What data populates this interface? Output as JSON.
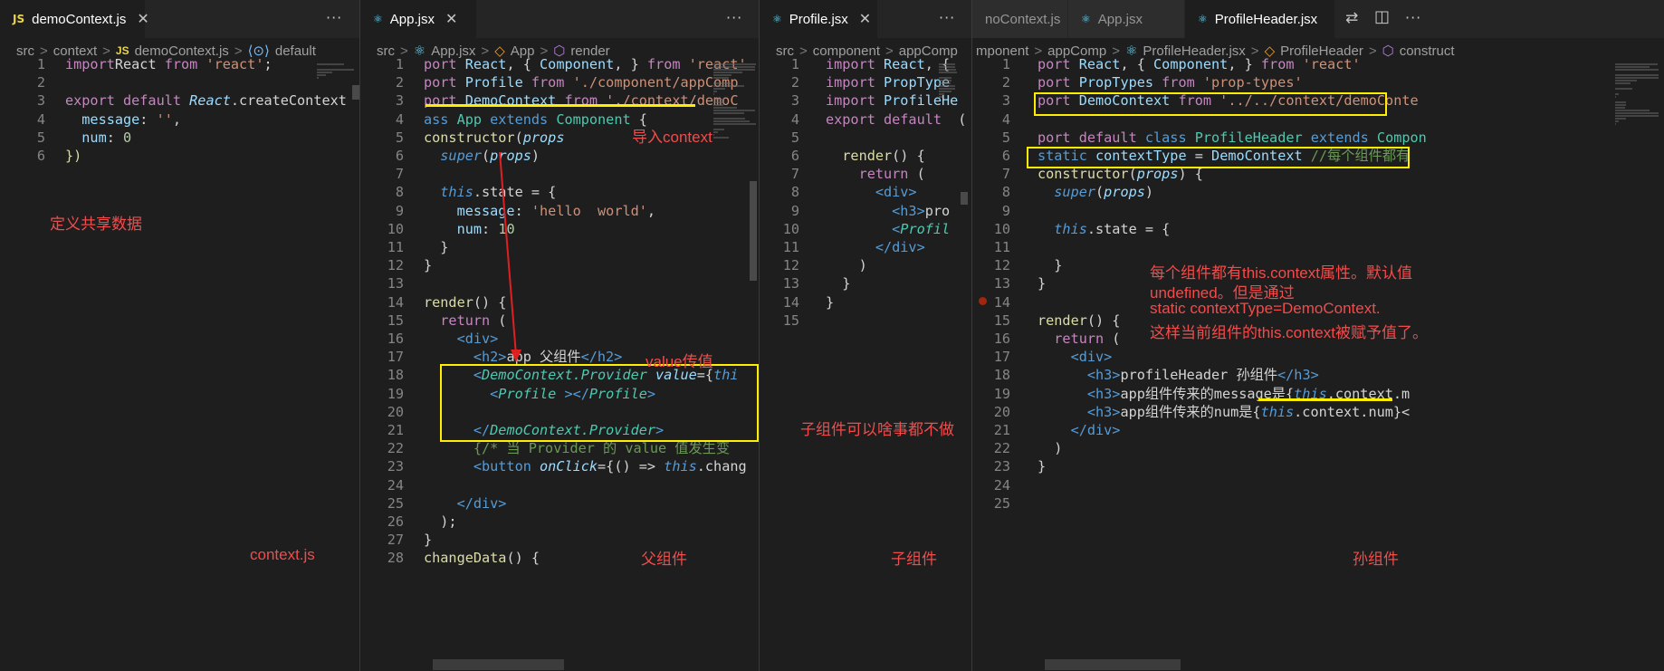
{
  "panes": [
    {
      "tab": {
        "icon": "JS",
        "title": "demoContext.js"
      },
      "breadcrumb": [
        "src",
        "context",
        "JS",
        "demoContext.js",
        "default"
      ],
      "lines": [
        [
          [
            "kw",
            "import"
          ],
          [
            "",
            "React"
          ],
          [
            "kw",
            " from"
          ],
          [
            "str",
            " 'react'"
          ],
          [
            "",
            ";"
          ]
        ],
        [],
        [
          [
            "kw",
            "export default"
          ],
          [
            "var it",
            " React"
          ],
          [
            "",
            ".createContext"
          ]
        ],
        [
          [
            "var",
            "  message"
          ],
          [
            "",
            ": "
          ],
          [
            "str",
            "''"
          ],
          [
            "",
            ","
          ]
        ],
        [
          [
            "var",
            "  num"
          ],
          [
            "",
            ": "
          ],
          [
            "num",
            "0"
          ]
        ],
        [
          [
            "fn",
            "})"
          ]
        ]
      ],
      "annotations": [
        "定义共享数据",
        "context.js"
      ]
    },
    {
      "tab": {
        "icon": "⚛",
        "title": "App.jsx"
      },
      "breadcrumb": [
        "src",
        "App.jsx",
        "App",
        "render"
      ],
      "lines": [
        [
          [
            "kw",
            "port"
          ],
          [
            "var",
            " React"
          ],
          [
            "",
            ", { "
          ],
          [
            "var",
            "Component"
          ],
          [
            "",
            ", } "
          ],
          [
            "kw",
            "from"
          ],
          [
            "str",
            " 'react'"
          ]
        ],
        [
          [
            "kw",
            "port"
          ],
          [
            "var",
            " Profile"
          ],
          [
            "kw",
            " from"
          ],
          [
            "str",
            " './component/appComp"
          ]
        ],
        [
          [
            "kw",
            "port"
          ],
          [
            "var",
            " DemoContext"
          ],
          [
            "kw",
            " from"
          ],
          [
            "str",
            " './context/demoC"
          ]
        ],
        [
          [
            "bl",
            "ass"
          ],
          [
            "cls",
            " App"
          ],
          [
            "bl",
            " extends"
          ],
          [
            "cls",
            " Component"
          ],
          [
            "",
            " {"
          ]
        ],
        [
          [
            "fn",
            "constructor"
          ],
          [
            "",
            "("
          ],
          [
            "var it",
            "props"
          ],
          [
            ") {",
            ""
          ]
        ],
        [
          [
            "bl it",
            "  super"
          ],
          [
            "",
            "("
          ],
          [
            "var it",
            "props"
          ],
          [
            "",
            ")"
          ]
        ],
        [],
        [
          [
            "bl it",
            "  this"
          ],
          [
            "",
            ".state = {"
          ]
        ],
        [
          [
            "var",
            "    message"
          ],
          [
            "",
            ": "
          ],
          [
            "str",
            "'hello  world'"
          ],
          [
            "",
            ","
          ]
        ],
        [
          [
            "var",
            "    num"
          ],
          [
            "",
            ": "
          ],
          [
            "num",
            "10"
          ]
        ],
        [
          [
            "",
            "  }"
          ]
        ],
        [
          [
            "",
            "}"
          ]
        ],
        [],
        [
          [
            "fn",
            "render"
          ],
          [
            "",
            "() {"
          ]
        ],
        [
          [
            "kw",
            "  return"
          ],
          [
            "",
            " ("
          ]
        ],
        [
          [
            "tag",
            "    <div>"
          ]
        ],
        [
          [
            "tag",
            "      <h2>"
          ],
          [
            "",
            "app 父组件"
          ],
          [
            "tag",
            "</h2>"
          ]
        ],
        [
          [
            "tag",
            "      <"
          ],
          [
            "cls it",
            "DemoContext.Provider"
          ],
          [
            "var it",
            " value"
          ],
          [
            "",
            "={"
          ],
          [
            "bl it",
            "thi"
          ]
        ],
        [
          [
            "tag",
            "        <"
          ],
          [
            "cls it",
            "Profile"
          ],
          [
            "tag",
            " ></"
          ],
          [
            "cls it",
            "Profile"
          ],
          [
            "tag",
            ">"
          ]
        ],
        [],
        [
          [
            "tag",
            "      </"
          ],
          [
            "cls it",
            "DemoContext.Provider"
          ],
          [
            "tag",
            ">"
          ]
        ],
        [
          [
            "cm",
            "      {/* 当 Provider 的 value 值发生变"
          ]
        ],
        [
          [
            "tag",
            "      <button"
          ],
          [
            "var it",
            " onClick"
          ],
          [
            "",
            "={() => "
          ],
          [
            "bl it",
            "this"
          ],
          [
            "",
            ".chang"
          ]
        ],
        [],
        [
          [
            "tag",
            "    </div>"
          ]
        ],
        [
          [
            "",
            "  );"
          ]
        ],
        [
          [
            "",
            "}"
          ]
        ],
        [
          [
            "fn",
            "changeData"
          ],
          [
            "",
            "() {"
          ]
        ]
      ],
      "annotations": [
        "导入context",
        "value传值",
        "父组件"
      ]
    },
    {
      "tab": {
        "icon": "⚛",
        "title": "Profile.jsx"
      },
      "breadcrumb": [
        "src",
        "component",
        "appComp"
      ],
      "lines": [
        [
          [
            "kw",
            "import"
          ],
          [
            "var",
            " React"
          ],
          [
            "",
            ", {"
          ]
        ],
        [
          [
            "kw",
            "import"
          ],
          [
            "var",
            " PropType"
          ]
        ],
        [
          [
            "kw",
            "import"
          ],
          [
            "var",
            " ProfileHe"
          ]
        ],
        [
          [
            "kw",
            "export default"
          ],
          [
            "",
            "  ("
          ]
        ],
        [],
        [
          [
            "fn",
            "  render"
          ],
          [
            "",
            "() {"
          ]
        ],
        [
          [
            "kw",
            "    return"
          ],
          [
            "",
            " ("
          ]
        ],
        [
          [
            "tag",
            "      <div>"
          ]
        ],
        [
          [
            "tag",
            "        <h3>"
          ],
          [
            "",
            "pro"
          ]
        ],
        [
          [
            "tag",
            "        <"
          ],
          [
            "cls it",
            "Profil"
          ]
        ],
        [
          [
            "tag",
            "      </div>"
          ]
        ],
        [
          [
            "",
            "    )"
          ]
        ],
        [
          [
            "",
            "  }"
          ]
        ],
        [
          [
            "",
            "}"
          ]
        ],
        []
      ],
      "annotations": [
        "子组件可以啥事都不做",
        "子组件"
      ]
    },
    {
      "tabs": [
        {
          "icon": "",
          "title": "noContext.js",
          "active": false
        },
        {
          "icon": "⚛",
          "title": "App.jsx",
          "active": false
        },
        {
          "icon": "⚛",
          "title": "ProfileHeader.jsx",
          "active": true
        }
      ],
      "breadcrumb": [
        "mponent",
        "appComp",
        "ProfileHeader.jsx",
        "ProfileHeader",
        "construct"
      ],
      "lines": [
        [
          [
            "kw",
            "port"
          ],
          [
            "var",
            " React"
          ],
          [
            "",
            ", { "
          ],
          [
            "var",
            "Component"
          ],
          [
            "",
            ", } "
          ],
          [
            "kw",
            "from"
          ],
          [
            "str",
            " 'react'"
          ]
        ],
        [
          [
            "kw",
            "port"
          ],
          [
            "var",
            " PropTypes"
          ],
          [
            "kw",
            " from"
          ],
          [
            "str",
            " 'prop-types'"
          ]
        ],
        [
          [
            "kw",
            "port"
          ],
          [
            "var",
            " DemoContext"
          ],
          [
            "kw",
            " from"
          ],
          [
            "str",
            " '../../context/demoConte"
          ]
        ],
        [],
        [
          [
            "kw",
            "port default"
          ],
          [
            "bl",
            " class"
          ],
          [
            "cls",
            " ProfileHeader"
          ],
          [
            "bl",
            " extends"
          ],
          [
            "cls",
            " Compon"
          ]
        ],
        [
          [
            "bl",
            "static"
          ],
          [
            "var",
            " contextType"
          ],
          [
            "",
            " = "
          ],
          [
            "var",
            "DemoContext"
          ],
          [
            "cm",
            " //每个组件都有"
          ]
        ],
        [
          [
            "fn",
            "constructor"
          ],
          [
            "",
            "("
          ],
          [
            "var it",
            "props"
          ],
          [
            "",
            ") {"
          ]
        ],
        [
          [
            "bl it",
            "  super"
          ],
          [
            "",
            "("
          ],
          [
            "var it",
            "props"
          ],
          [
            "",
            ")"
          ]
        ],
        [],
        [
          [
            "bl it",
            "  this"
          ],
          [
            "",
            ".state = {"
          ]
        ],
        [],
        [
          [
            "",
            "  }"
          ]
        ],
        [
          [
            "",
            "}"
          ]
        ],
        [],
        [
          [
            "fn",
            "render"
          ],
          [
            "",
            "() {"
          ]
        ],
        [
          [
            "kw",
            "  return"
          ],
          [
            "",
            " ("
          ]
        ],
        [
          [
            "tag",
            "    <div>"
          ]
        ],
        [
          [
            "tag",
            "      <h3>"
          ],
          [
            "",
            "profileHeader 孙组件"
          ],
          [
            "tag",
            "</h3>"
          ]
        ],
        [
          [
            "tag",
            "      <h3>"
          ],
          [
            "",
            "app组件传来的message是{"
          ],
          [
            "bl it",
            "this"
          ],
          [
            "",
            ".context.m"
          ]
        ],
        [
          [
            "tag",
            "      <h3>"
          ],
          [
            "",
            "app组件传来的num是{"
          ],
          [
            "bl it",
            "this"
          ],
          [
            "",
            ".context.num}<"
          ]
        ],
        [
          [
            "tag",
            "    </div>"
          ]
        ],
        [
          [
            "",
            "  )"
          ]
        ],
        [
          [
            "",
            "}"
          ]
        ],
        [],
        []
      ],
      "annotations": [
        "每个组件都有this.context属性。默认值",
        "undefined。但是通过",
        "static contextType=DemoContext.",
        "这样当前组件的this.context被赋予值了。",
        "孙组件"
      ]
    }
  ],
  "more_label": "···",
  "close_label": "✕",
  "crumb_sep": ">"
}
